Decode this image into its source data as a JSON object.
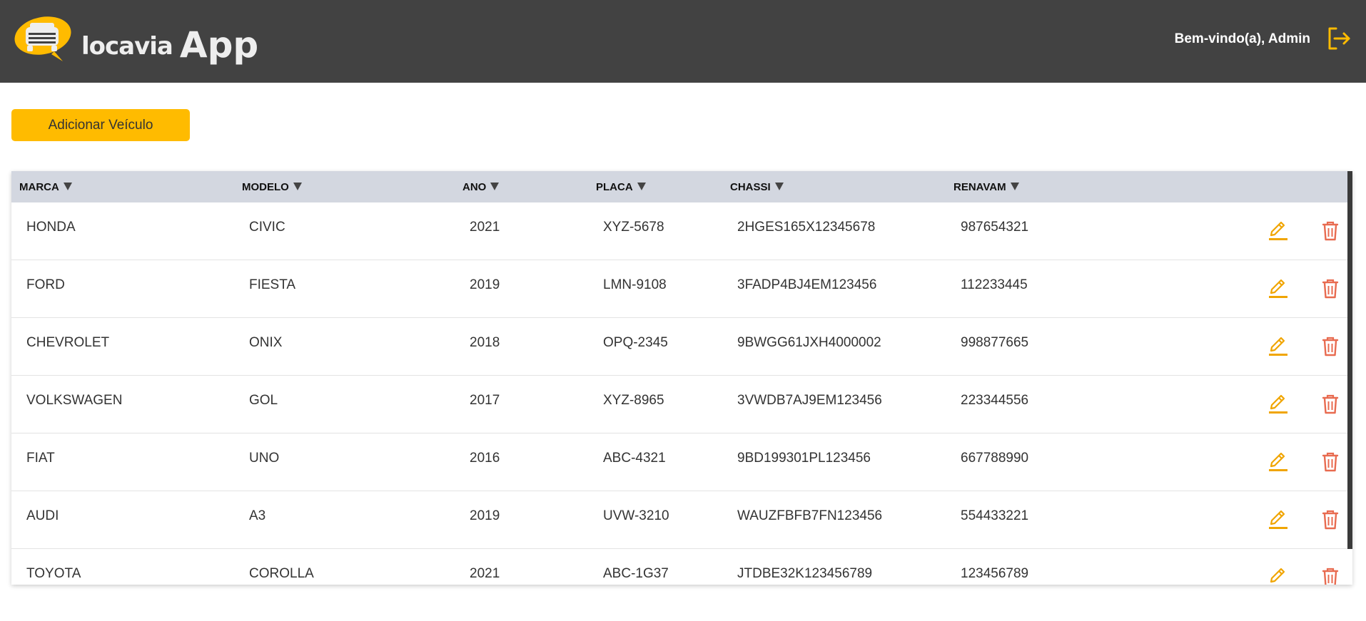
{
  "app": {
    "brand": "locavia",
    "suffix": "App",
    "welcome": "Bem-vindo(a), Admin"
  },
  "colors": {
    "accent": "#ffbb00",
    "topbar": "#424242",
    "header_bg": "#d3d7e0",
    "edit_icon": "#f0a500",
    "delete_icon": "#e86b50"
  },
  "actions": {
    "add_label": "Adicionar Veículo"
  },
  "table": {
    "columns": [
      "MARCA",
      "MODELO",
      "ANO",
      "PLACA",
      "CHASSI",
      "RENAVAM"
    ],
    "rows": [
      [
        "HONDA",
        "CIVIC",
        "2021",
        "XYZ-5678",
        "2HGES165X12345678",
        "987654321"
      ],
      [
        "FORD",
        "FIESTA",
        "2019",
        "LMN-9108",
        "3FADP4BJ4EM123456",
        "112233445"
      ],
      [
        "CHEVROLET",
        "ONIX",
        "2018",
        "OPQ-2345",
        "9BWGG61JXH4000002",
        "998877665"
      ],
      [
        "VOLKSWAGEN",
        "GOL",
        "2017",
        "XYZ-8965",
        "3VWDB7AJ9EM123456",
        "223344556"
      ],
      [
        "FIAT",
        "UNO",
        "2016",
        "ABC-4321",
        "9BD199301PL123456",
        "667788990"
      ],
      [
        "AUDI",
        "A3",
        "2019",
        "UVW-3210",
        "WAUZFBFB7FN123456",
        "554433221"
      ],
      [
        "TOYOTA",
        "COROLLA",
        "2021",
        "ABC-1G37",
        "JTDBE32K123456789",
        "123456789"
      ]
    ],
    "row_icons": {
      "edit": "pencil-icon",
      "delete": "trash-icon"
    }
  }
}
